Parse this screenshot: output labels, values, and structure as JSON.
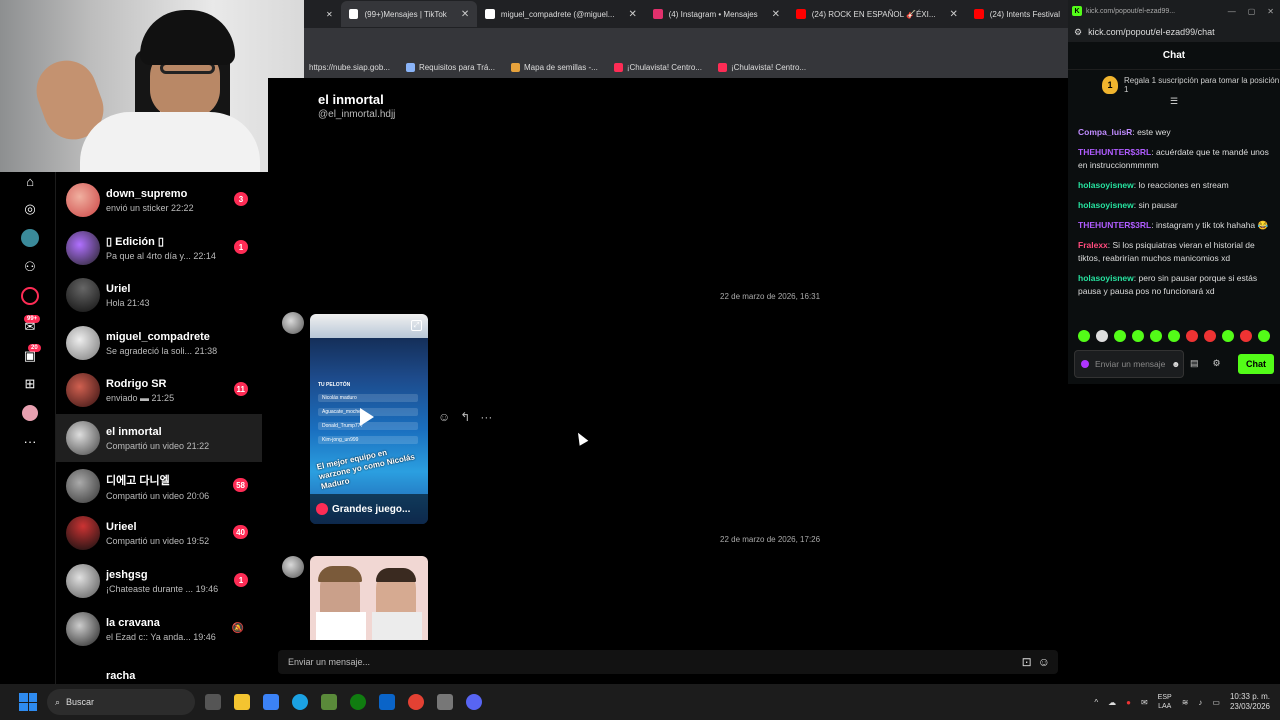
{
  "browser": {
    "tabs": [
      {
        "label": "(99+)Mensajes | TikTok",
        "active": true,
        "color": "#ffffff"
      },
      {
        "label": "miguel_compadrete (@miguel...",
        "active": false,
        "color": "#ffffff"
      },
      {
        "label": "(4) Instagram • Mensajes",
        "active": false,
        "color": "#e1306c"
      },
      {
        "label": "(24) ROCK EN ESPAÑOL 🎸ÉXI...",
        "active": false,
        "color": "#ff0000"
      },
      {
        "label": "(24) Intents Festival",
        "active": false,
        "color": "#ff0000"
      }
    ],
    "bookmarks": [
      {
        "label": "https://nube.siap.gob...",
        "color": "#888888"
      },
      {
        "label": "Requisitos para Trá...",
        "color": "#8ab4f8"
      },
      {
        "label": "Mapa de semillas -...",
        "color": "#e6a23c"
      },
      {
        "label": "¡Chulavista! Centro...",
        "color": "#fe2c55"
      },
      {
        "label": "¡Chulavista! Centro...",
        "color": "#fe2c55"
      }
    ]
  },
  "rail": {
    "badge_messages": "99+",
    "badge_inbox": "20"
  },
  "conversations": [
    {
      "name": "down_supremo",
      "preview": "envió un sticker",
      "time": "22:22",
      "badge": "3",
      "avatar_color": "#d66"
    },
    {
      "name": "▯ Edición ▯",
      "preview": "Pa que al 4rto día y...",
      "time": "22:14",
      "badge": "1",
      "avatar_color": "#6a3fb5"
    },
    {
      "name": "Uriel",
      "preview": "Hola",
      "time": "21:43",
      "badge": "",
      "avatar_color": "#444"
    },
    {
      "name": "miguel_compadrete",
      "preview": "Se agradeció la soli...",
      "time": "21:38",
      "badge": "",
      "avatar_color": "#8a8a8a"
    },
    {
      "name": "Rodrigo SR",
      "preview": "enviado ▬",
      "time": "21:25",
      "badge": "11",
      "avatar_color": "#a33"
    },
    {
      "name": "el inmortal",
      "preview": "Compartió un video",
      "time": "21:22",
      "badge": "",
      "avatar_color": "#777",
      "selected": true
    },
    {
      "name": "디에고 다니엘",
      "preview": "Compartió un video",
      "time": "20:06",
      "badge": "58",
      "avatar_color": "#5a5a5a"
    },
    {
      "name": "Urieel",
      "preview": "Compartió un video",
      "time": "19:52",
      "badge": "40",
      "avatar_color": "#333"
    },
    {
      "name": "jeshgsg",
      "preview": "¡Chateaste durante ...",
      "time": "19:46",
      "badge": "1",
      "avatar_color": "#999"
    },
    {
      "name": "la cravana",
      "preview": "el Ezad c:: Ya anda...",
      "time": "19:46",
      "badge": "",
      "muted": true,
      "avatar_color": "#666"
    },
    {
      "name": "racha",
      "preview": "",
      "time": "",
      "badge": "",
      "avatar_color": "#555"
    }
  ],
  "chat": {
    "name": "el inmortal",
    "handle": "@el_inmortal.hdjj",
    "timestamp1": "22 de marzo de 2026, 16:31",
    "timestamp2": "22 de marzo de 2026, 17:26",
    "video1_title": "Grandes juego...",
    "video1_caption": "El mejor equipo en warzone yo como Nicolás Maduro",
    "video1_header": "TU PELOTÓN",
    "video1_rows": [
      "Nicolás maduro",
      "Aguacate_mochet_",
      "Donald_Trump777",
      "Kim-jong_un999"
    ],
    "input_placeholder": "Enviar un mensaje..."
  },
  "kick": {
    "title": "kick.com/popout/el-ezad99...",
    "url": "kick.com/popout/el-ezad99/chat",
    "chat_title": "Chat",
    "sub_promo": "Regala 1 suscripción para tomar la posición 1",
    "messages": [
      {
        "user": "Compa_luisR",
        "text": "este wey",
        "color": "#c08cff"
      },
      {
        "user": "THEHUNTER$3RL",
        "text": "acuérdate que te mandé unos en instruccionmmmm",
        "color": "#b05cff"
      },
      {
        "user": "holasoyisnew",
        "text": "lo reacciones en stream",
        "color": "#27e3a0"
      },
      {
        "user": "holasoyisnew",
        "text": "sin pausar",
        "color": "#27e3a0"
      },
      {
        "user": "THEHUNTER$3RL",
        "text": "instagram y tik tok hahaha 😂",
        "color": "#b05cff"
      },
      {
        "user": "Fralexx",
        "text": "Si los psiquiatras vieran el historial de tiktos, reabrirían muchos manicomios xd",
        "color": "#ff4b7d"
      },
      {
        "user": "holasoyisnew",
        "text": "pero sin pausar porque si estás pausa y pausa pos no funcionará xd",
        "color": "#27e3a0"
      }
    ],
    "input_placeholder": "Enviar un mensaje",
    "send_label": "Chat"
  },
  "taskbar": {
    "search_label": "Buscar",
    "lang_top": "ESP",
    "lang_bottom": "LAA",
    "time": "10:33 p. m.",
    "date": "23/03/2026"
  }
}
